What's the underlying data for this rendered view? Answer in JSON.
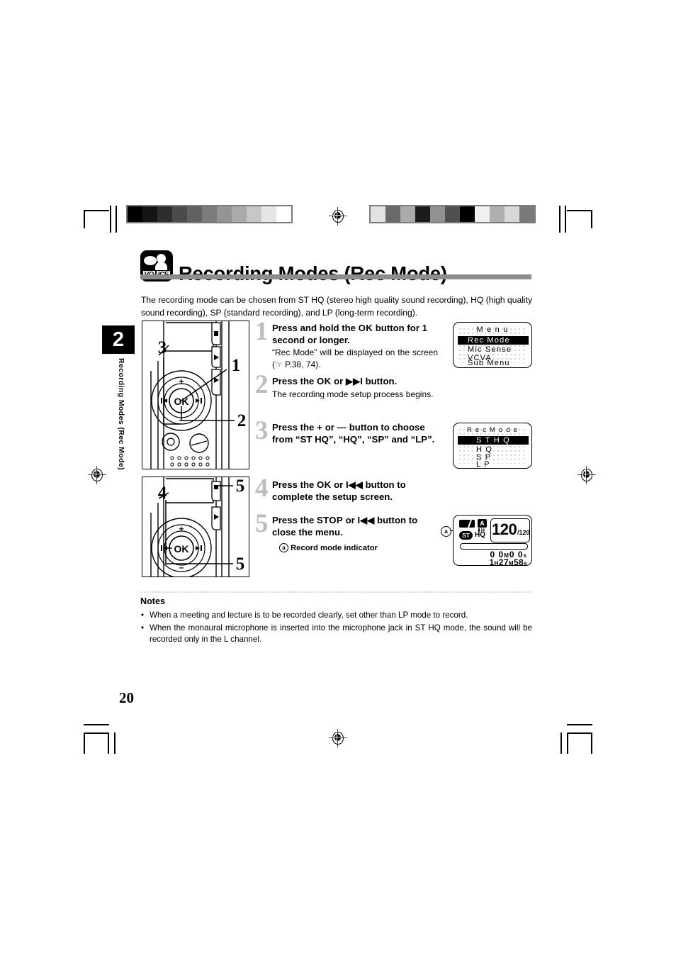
{
  "document": {
    "page_number": "20",
    "chapter_number": "2",
    "chapter_label": "Recording Modes (Rec Mode)",
    "title": "Recording Modes (Rec Mode)",
    "logo_text_left": "VO",
    "logo_text_right": "ICE",
    "intro": "The recording mode can be chosen from ST HQ (stereo high quality sound recording),  HQ (high quality sound recording), SP (standard recording), and LP (long-term recording)."
  },
  "steps": [
    {
      "number": "1",
      "heading_parts": [
        "Press and hold the ",
        "OK",
        " button for 1 second or longer."
      ],
      "heading": "Press and hold the OK button for 1 second or longer.",
      "body": "“Rec Mode” will be displayed on the screen (☞ P.38, 74)."
    },
    {
      "number": "2",
      "heading_parts": [
        "Press the ",
        "OK",
        " or ",
        "▶▶I",
        " button."
      ],
      "heading": "Press the OK or ▶▶I button.",
      "body": "The recording mode setup process begins."
    },
    {
      "number": "3",
      "heading_parts": [
        "Press the ",
        "+",
        " or ",
        "—",
        " button to choose from “ST HQ”, “HQ”, “SP” and “LP”."
      ],
      "heading": "Press the + or — button to choose from “ST HQ”, “HQ”, “SP” and “LP”.",
      "body": ""
    },
    {
      "number": "4",
      "heading_parts": [
        "Press the ",
        "OK",
        " or ",
        "I◀◀",
        " button to complete the setup screen."
      ],
      "heading": "Press the OK or I◀◀ button to complete the setup screen.",
      "body": ""
    },
    {
      "number": "5",
      "heading_parts": [
        "Press the ",
        "STOP",
        " or ",
        "I◀◀",
        " button to close the menu."
      ],
      "heading": "Press the STOP or I◀◀ button to close the menu.",
      "body": "",
      "caption_marker": "a",
      "caption": "Record mode indicator"
    }
  ],
  "lcd_menu": {
    "title": "M e n u",
    "items": [
      {
        "label": "Rec Mode",
        "selected": true
      },
      {
        "label": "Mic Sense",
        "selected": false
      },
      {
        "label": "VCVA",
        "selected": false
      },
      {
        "label": "Sub Menu",
        "selected": false
      }
    ]
  },
  "lcd_recmode": {
    "title": "R e c   M o d e",
    "items": [
      {
        "label": "S T  H Q",
        "selected": true
      },
      {
        "label": "H Q",
        "selected": false
      },
      {
        "label": "S P",
        "selected": false
      },
      {
        "label": "L P",
        "selected": false
      }
    ]
  },
  "lcd_status": {
    "battery_icon": "battery-icon",
    "alarm_icon": "A",
    "mic_icon": "⬇H",
    "stereo_badge": "ST",
    "quality": "HQ",
    "file_number": "120",
    "file_total": "/120",
    "elapsed_time": "0 0 M 0 0 s",
    "elapsed_minutes": "0 0",
    "elapsed_seconds": "0 0",
    "remain_hours": "1",
    "remain_minutes": "27",
    "remain_seconds": "58",
    "callout_marker": "a"
  },
  "device_callouts": {
    "top": [
      "3",
      "1",
      "2"
    ],
    "bottom": [
      "4",
      "5",
      "5"
    ],
    "ok_label": "OK",
    "plus_label": "+",
    "minus_label": "—"
  },
  "notes": {
    "title": "Notes",
    "items": [
      "When a meeting and lecture is to be recorded clearly, set other than LP mode to record.",
      "When the monaural microphone is inserted into the microphone jack in ST HQ mode, the sound will be recorded only in the L channel."
    ]
  },
  "print_marks": {
    "greyscale_left": [
      "#000000",
      "#151515",
      "#2e2e2e",
      "#4b4b4b",
      "#616161",
      "#7b7b7b",
      "#949494",
      "#aaaaaa",
      "#c7c7c7",
      "#e6e6e6",
      "#ffffff"
    ],
    "greyscale_right": [
      "#e2e2e2",
      "#6a6a6a",
      "#ababab",
      "#1c1c1c",
      "#919191",
      "#4f4f4f",
      "#000000",
      "#f0f0f0",
      "#b0b0b0",
      "#d8d8d8",
      "#7a7a7a"
    ]
  }
}
